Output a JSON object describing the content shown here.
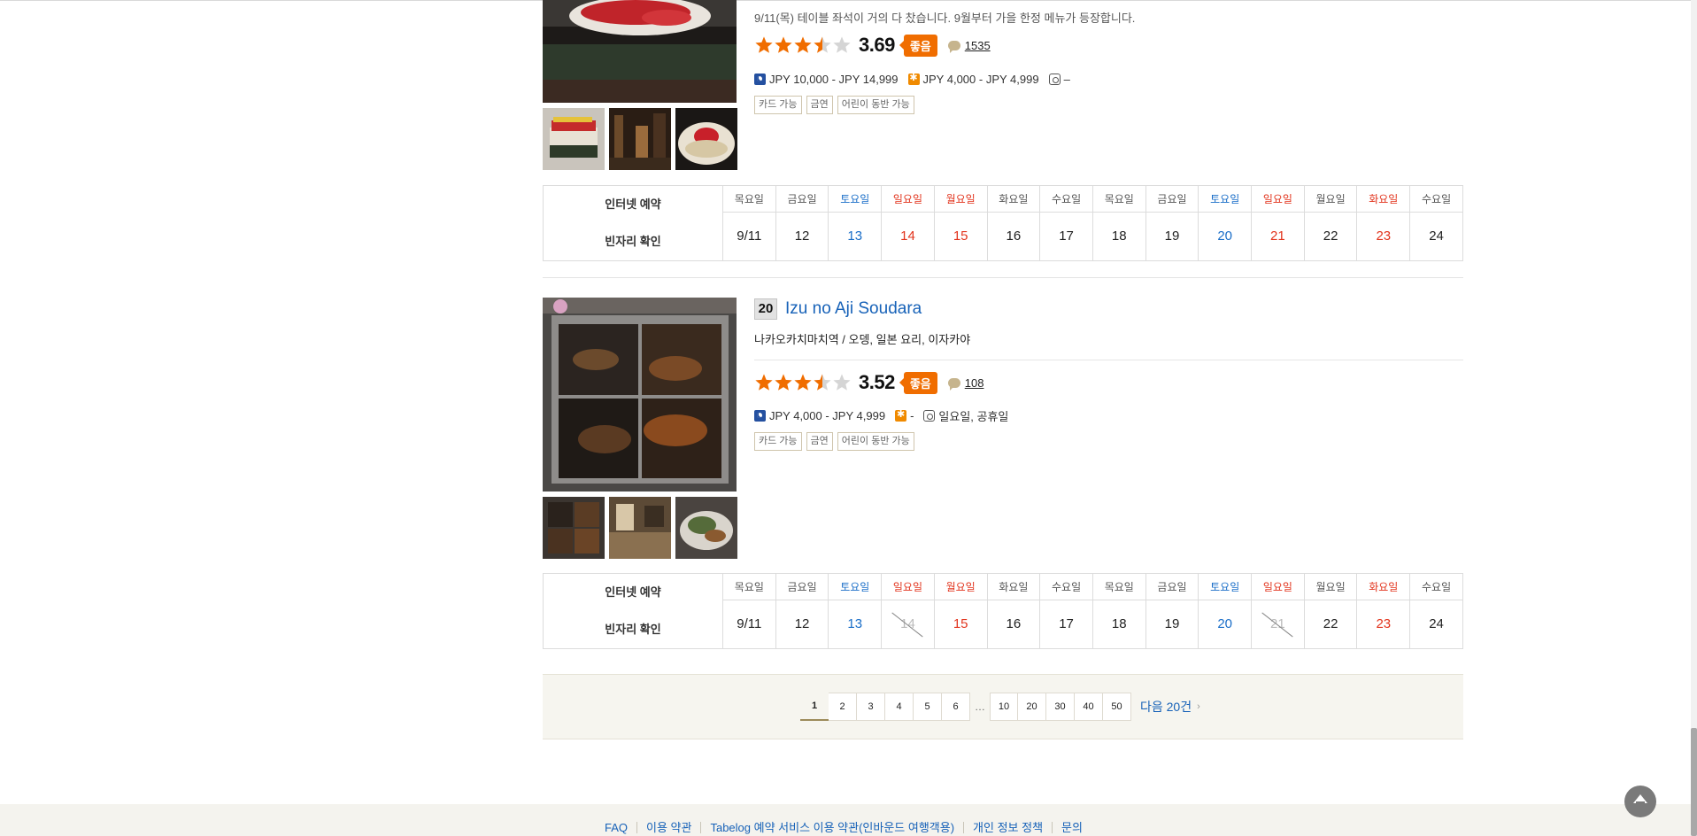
{
  "listings": [
    {
      "notice": "9/11(목) 테이블 좌석이 거의 다 찼습니다. 9월부터 가을 한정 메뉴가 등장합니다.",
      "rating": 3.69,
      "rating_display": "3.69",
      "rating_badge": "좋음",
      "review_count": "1535",
      "dinner_price": "JPY 10,000 - JPY 14,999",
      "lunch_price": "JPY 4,000 - JPY 4,999",
      "holiday": "–",
      "tags": [
        "카드 가능",
        "금연",
        "어린이 동반 가능"
      ]
    },
    {
      "rank": "20",
      "name": "Izu no Aji Soudara",
      "genre": "나카오카치마치역 / 오뎅, 일본 요리, 이자카야",
      "rating": 3.52,
      "rating_display": "3.52",
      "rating_badge": "좋음",
      "review_count": "108",
      "dinner_price": "JPY 4,000 - JPY 4,999",
      "lunch_price": "-",
      "holiday": "일요일, 공휴일",
      "tags": [
        "카드 가능",
        "금연",
        "어린이 동반 가능"
      ]
    }
  ],
  "availability": {
    "label_top": "인터넷 예약",
    "label_bottom": "빈자리 확인",
    "days": [
      {
        "dow": "목요일",
        "date": "9/11",
        "kind": "weekday"
      },
      {
        "dow": "금요일",
        "date": "12",
        "kind": "weekday"
      },
      {
        "dow": "토요일",
        "date": "13",
        "kind": "sat"
      },
      {
        "dow": "일요일",
        "date": "14",
        "kind": "sun"
      },
      {
        "dow": "월요일",
        "date": "15",
        "kind": "sun"
      },
      {
        "dow": "화요일",
        "date": "16",
        "kind": "weekday"
      },
      {
        "dow": "수요일",
        "date": "17",
        "kind": "weekday"
      },
      {
        "dow": "목요일",
        "date": "18",
        "kind": "weekday"
      },
      {
        "dow": "금요일",
        "date": "19",
        "kind": "weekday"
      },
      {
        "dow": "토요일",
        "date": "20",
        "kind": "sat"
      },
      {
        "dow": "일요일",
        "date": "21",
        "kind": "sun"
      },
      {
        "dow": "월요일",
        "date": "22",
        "kind": "weekday"
      },
      {
        "dow": "화요일",
        "date": "23",
        "kind": "sun"
      },
      {
        "dow": "수요일",
        "date": "24",
        "kind": "weekday"
      }
    ],
    "unavailable_listing2": [
      "14",
      "21"
    ]
  },
  "pagination": {
    "current": "1",
    "pages": [
      "1",
      "2",
      "3",
      "4",
      "5",
      "6"
    ],
    "ellipsis": "…",
    "jump_pages": [
      "10",
      "20",
      "30",
      "40",
      "50"
    ],
    "next_label": "다음 20건",
    "next_arrow": "›"
  },
  "footer": {
    "links": [
      "FAQ",
      "이용 약관",
      "Tabelog 예약 서비스 이용 약관(인바운드 여행객용)",
      "개인 정보 정책",
      "문의"
    ]
  },
  "icons": {
    "dinner": "moon-icon",
    "lunch": "sun-icon",
    "holiday": "closed-day-icon",
    "review": "speech-bubble-icon",
    "to_top": "chevron-up-icon"
  },
  "colors": {
    "link": "#1762b8",
    "star": "#f06d00",
    "badge": "#f06d00",
    "saturday": "#1a6ec8",
    "holiday": "#e2341d"
  }
}
